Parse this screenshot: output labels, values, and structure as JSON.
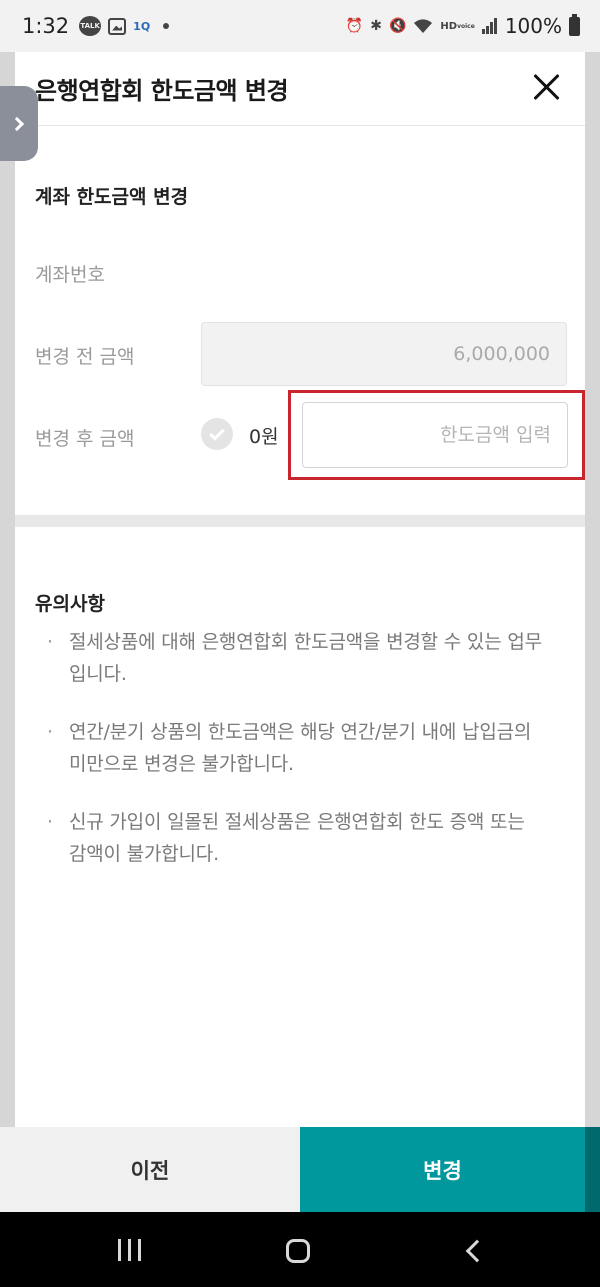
{
  "status_bar": {
    "time": "1:32",
    "notification_icons": [
      "talk-icon",
      "gallery-icon",
      "app-icon",
      "dot-icon"
    ],
    "talk_label": "TALK",
    "app_label": "1Q",
    "system_icons": [
      "alarm-icon",
      "bluetooth-icon",
      "mute-icon",
      "wifi-icon",
      "hd-voice-icon",
      "signal-icon",
      "battery-icon"
    ],
    "hd_label": "HD",
    "voice_label": "voice",
    "battery": "100%"
  },
  "modal": {
    "title": "은행연합회 한도금액 변경",
    "section_title": "계좌 한도금액 변경",
    "account_label": "계좌번호",
    "before_label": "변경 전 금액",
    "before_value": "6,000,000",
    "after_label": "변경 후 금액",
    "after_unit_value": "0원",
    "limit_input": {
      "value": "",
      "placeholder": "한도금액 입력"
    },
    "notes_title": "유의사항",
    "notes": [
      "절세상품에 대해 은행연합회 한도금액을 변경할 수 있는 업무입니다.",
      "연간/분기 상품의 한도금액은 해당 연간/분기 내에 납입금의 미만으로 변경은 불가합니다.",
      "신규 가입이 일몰된 절세상품은 은행연합회 한도 증액 또는 감액이 불가합니다."
    ]
  },
  "buttons": {
    "prev": "이전",
    "change": "변경"
  },
  "colors": {
    "accent": "#00979d",
    "highlight": "#c8262c",
    "side_tab": "#8a8f99"
  }
}
